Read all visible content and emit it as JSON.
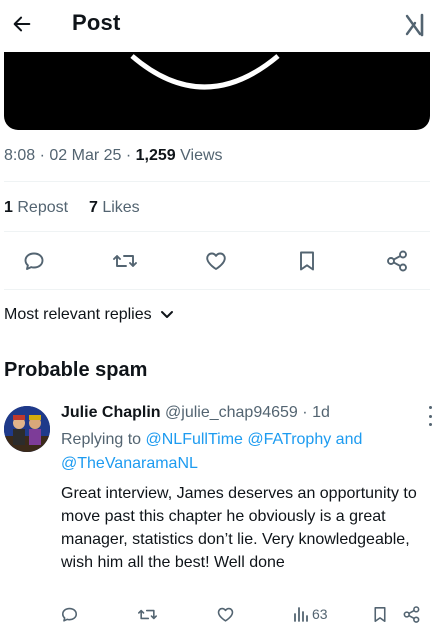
{
  "header": {
    "title": "Post"
  },
  "post": {
    "time": "8:08",
    "date": "02 Mar 25",
    "views_count": "1,259",
    "views_label": "Views",
    "reposts_count": "1",
    "reposts_label": "Repost",
    "likes_count": "7",
    "likes_label": "Likes"
  },
  "replies_sort": {
    "label": "Most relevant replies"
  },
  "section": {
    "title": "Probable spam"
  },
  "reply": {
    "name": "Julie Chaplin",
    "handle": "@julie_chap94659",
    "time": "1d",
    "replying_to_label": "Replying to",
    "mentions": [
      "@NLFullTime",
      "@FATrophy",
      "@TheVanaramaNL"
    ],
    "and_word": "and",
    "text": "Great interview, James deserves an opportunity to move past this chapter he obviously is a great manager, statistics don’t lie. Very knowledgeable, wish him all the best! Well done",
    "views_count": "63"
  },
  "icons": {
    "back": "arrow-left-icon",
    "grok": "grok-icon",
    "reply": "comment-icon",
    "repost": "repost-icon",
    "like": "heart-icon",
    "bookmark": "bookmark-icon",
    "share": "share-icon",
    "views": "bar-chart-icon",
    "more": "more-vertical-icon",
    "chevron": "chevron-down-icon"
  },
  "colors": {
    "text": "#0f1419",
    "secondary": "#536471",
    "link": "#1d9bf0",
    "divider": "#eff3f4"
  }
}
